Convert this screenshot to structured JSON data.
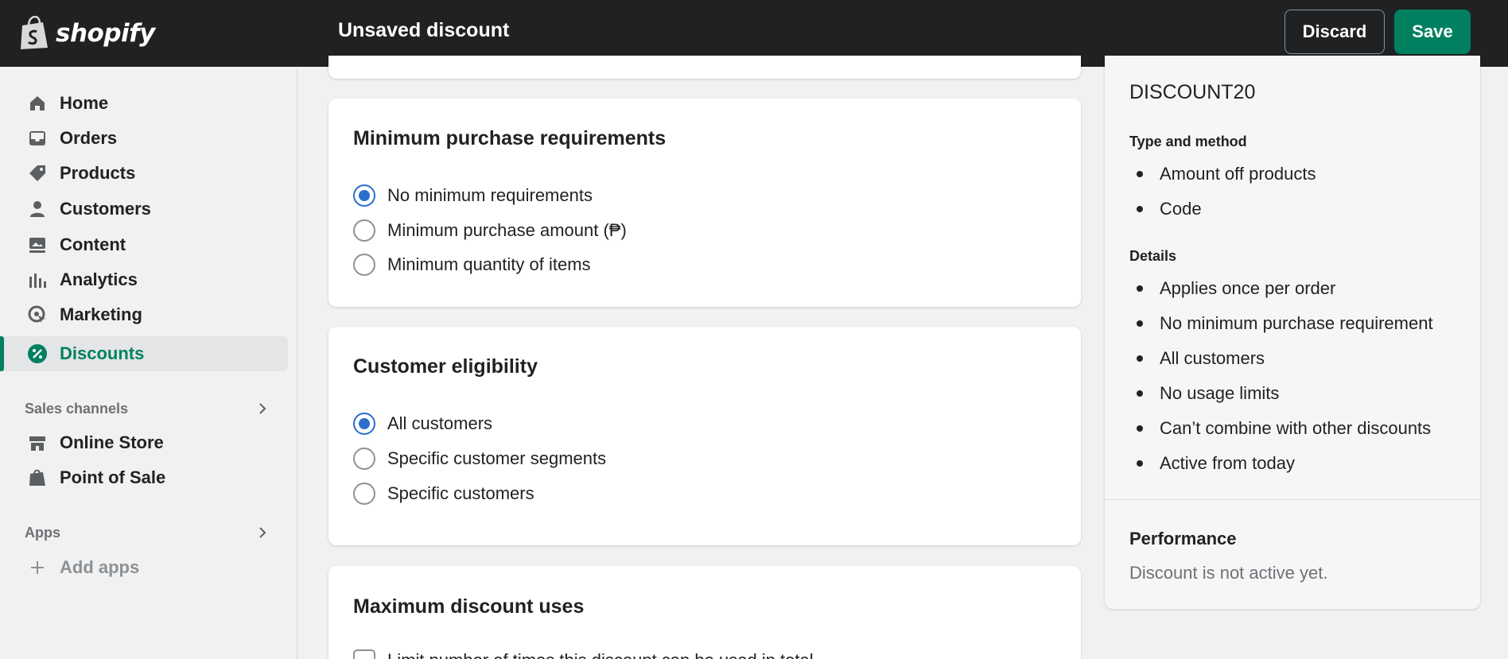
{
  "app": {
    "name": "shopify",
    "brand_color": "#008060",
    "topbar_color": "#202123"
  },
  "header": {
    "title": "Unsaved discount",
    "discard_label": "Discard",
    "save_label": "Save"
  },
  "sidebar": {
    "items": [
      {
        "label": "Home",
        "icon": "home-icon"
      },
      {
        "label": "Orders",
        "icon": "inbox-icon"
      },
      {
        "label": "Products",
        "icon": "tag-icon"
      },
      {
        "label": "Customers",
        "icon": "person-icon"
      },
      {
        "label": "Content",
        "icon": "image-icon"
      },
      {
        "label": "Analytics",
        "icon": "bar-chart-icon"
      },
      {
        "label": "Marketing",
        "icon": "target-icon"
      },
      {
        "label": "Discounts",
        "icon": "discount-badge-icon",
        "active": true
      }
    ],
    "sales_channels": {
      "heading": "Sales channels",
      "items": [
        {
          "label": "Online Store",
          "icon": "store-icon"
        },
        {
          "label": "Point of Sale",
          "icon": "pos-bag-icon"
        }
      ]
    },
    "apps": {
      "heading": "Apps",
      "add_label": "Add apps"
    }
  },
  "main": {
    "min_purchase": {
      "title": "Minimum purchase requirements",
      "options": [
        "No minimum requirements",
        "Minimum purchase amount (₱)",
        "Minimum quantity of items"
      ],
      "selected": 0
    },
    "eligibility": {
      "title": "Customer eligibility",
      "options": [
        "All customers",
        "Specific customer segments",
        "Specific customers"
      ],
      "selected": 0
    },
    "max_uses": {
      "title": "Maximum discount uses",
      "option": "Limit number of times this discount can be used in total"
    }
  },
  "summary": {
    "code": "DISCOUNT20",
    "type_heading": "Type and method",
    "type_items": [
      "Amount off products",
      "Code"
    ],
    "details_heading": "Details",
    "details_items": [
      "Applies once per order",
      "No minimum purchase requirement",
      "All customers",
      "No usage limits",
      "Can’t combine with other discounts",
      "Active from today"
    ],
    "performance_title": "Performance",
    "performance_text": "Discount is not active yet."
  }
}
